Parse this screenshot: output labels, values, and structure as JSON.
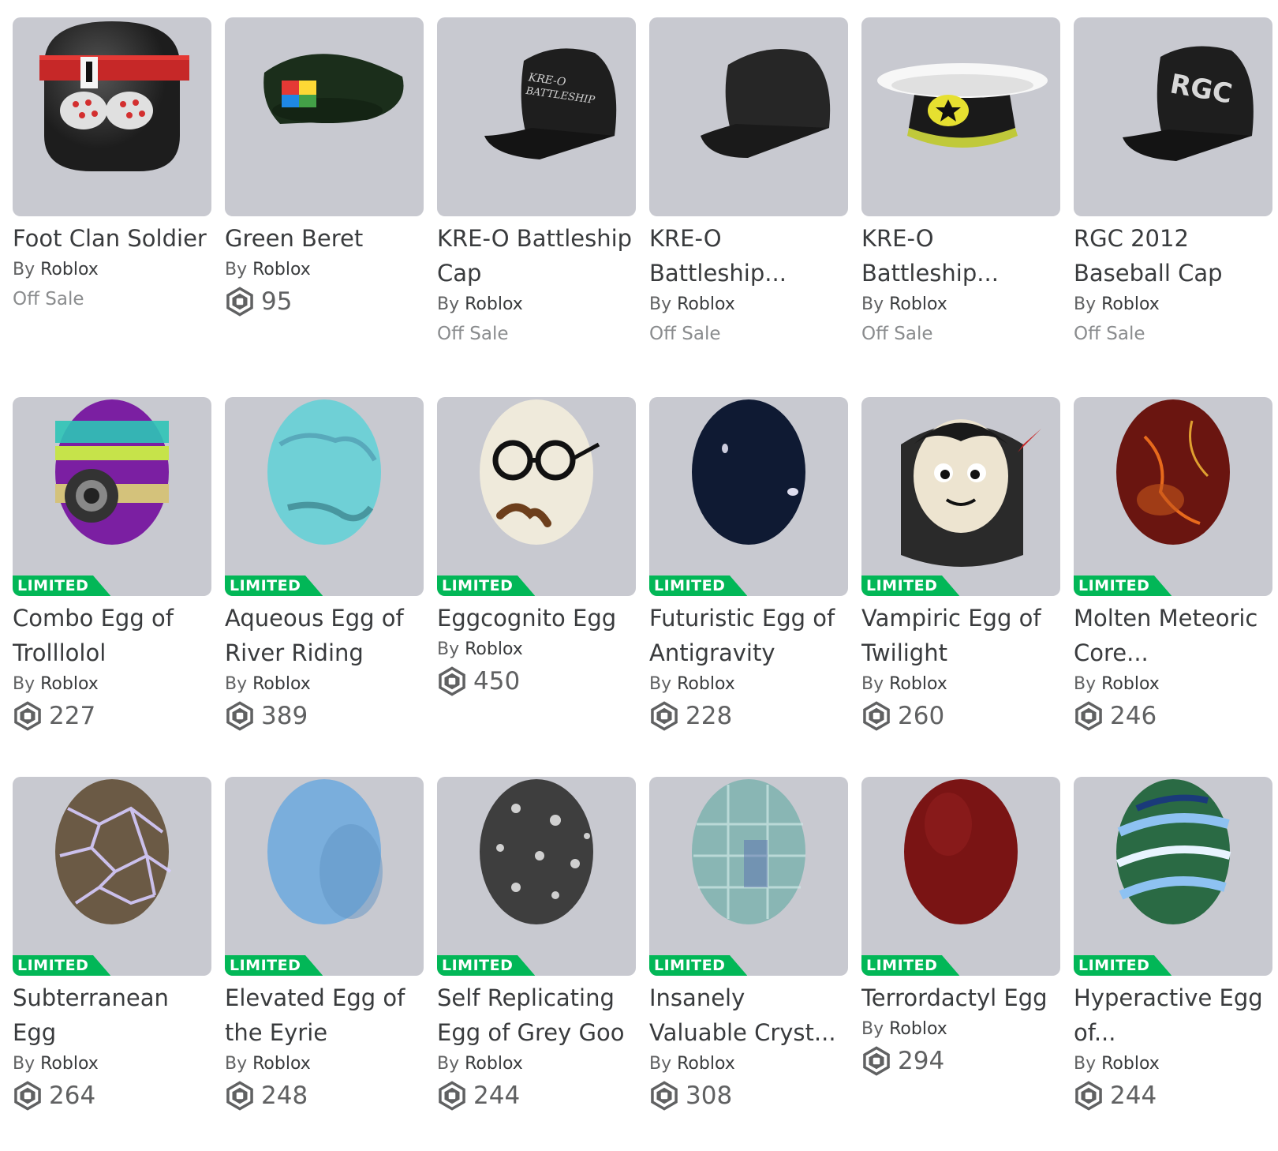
{
  "items": [
    {
      "name": "Foot Clan Soldier",
      "by": "By",
      "creator": "Roblox",
      "price": null,
      "status": "Off Sale",
      "limited": false,
      "art": "foot-clan"
    },
    {
      "name": "Green Beret",
      "by": "By",
      "creator": "Roblox",
      "price": "95",
      "status": null,
      "limited": false,
      "art": "beret"
    },
    {
      "name": "KRE-O Battleship Cap",
      "by": "By",
      "creator": "Roblox",
      "price": null,
      "status": "Off Sale",
      "limited": false,
      "art": "cap-logo"
    },
    {
      "name": "KRE-O Battleship...",
      "by": "By",
      "creator": "Roblox",
      "price": null,
      "status": "Off Sale",
      "limited": false,
      "art": "cap-plain"
    },
    {
      "name": "KRE-O Battleship...",
      "by": "By",
      "creator": "Roblox",
      "price": null,
      "status": "Off Sale",
      "limited": false,
      "art": "captain"
    },
    {
      "name": "RGC 2012 Baseball Cap",
      "by": "By",
      "creator": "Roblox",
      "price": null,
      "status": "Off Sale",
      "limited": false,
      "art": "cap-rgc"
    },
    {
      "name": "Combo Egg of Trolllolol",
      "by": "By",
      "creator": "Roblox",
      "price": "227",
      "status": null,
      "limited": true,
      "art": "egg-combo"
    },
    {
      "name": "Aqueous Egg of River Riding",
      "by": "By",
      "creator": "Roblox",
      "price": "389",
      "status": null,
      "limited": true,
      "art": "egg-aqua"
    },
    {
      "name": "Eggcognito Egg",
      "by": "By",
      "creator": "Roblox",
      "price": "450",
      "status": null,
      "limited": true,
      "art": "egg-cognito"
    },
    {
      "name": "Futuristic Egg of Antigravity",
      "by": "By",
      "creator": "Roblox",
      "price": "228",
      "status": null,
      "limited": true,
      "art": "egg-navy"
    },
    {
      "name": "Vampiric Egg of Twilight",
      "by": "By",
      "creator": "Roblox",
      "price": "260",
      "status": null,
      "limited": true,
      "art": "egg-vamp"
    },
    {
      "name": "Molten Meteoric Core...",
      "by": "By",
      "creator": "Roblox",
      "price": "246",
      "status": null,
      "limited": true,
      "art": "egg-molten"
    },
    {
      "name": "Subterranean Egg",
      "by": "By",
      "creator": "Roblox",
      "price": "264",
      "status": null,
      "limited": true,
      "art": "egg-subter"
    },
    {
      "name": "Elevated Egg of the Eyrie",
      "by": "By",
      "creator": "Roblox",
      "price": "248",
      "status": null,
      "limited": true,
      "art": "egg-sky"
    },
    {
      "name": "Self Replicating Egg of Grey Goo",
      "by": "By",
      "creator": "Roblox",
      "price": "244",
      "status": null,
      "limited": true,
      "art": "egg-grey"
    },
    {
      "name": "Insanely Valuable Cryst...",
      "by": "By",
      "creator": "Roblox",
      "price": "308",
      "status": null,
      "limited": true,
      "art": "egg-crystal"
    },
    {
      "name": "Terrordactyl Egg",
      "by": "By",
      "creator": "Roblox",
      "price": "294",
      "status": null,
      "limited": true,
      "art": "egg-red"
    },
    {
      "name": "Hyperactive Egg of...",
      "by": "By",
      "creator": "Roblox",
      "price": "244",
      "status": null,
      "limited": true,
      "art": "egg-stripe"
    }
  ],
  "limited_label": "LIMITED",
  "colors": {
    "thumb_bg": "#c8c9d0",
    "limited_green": "#02b757",
    "text": "#393b3d",
    "muted": "#606162"
  }
}
